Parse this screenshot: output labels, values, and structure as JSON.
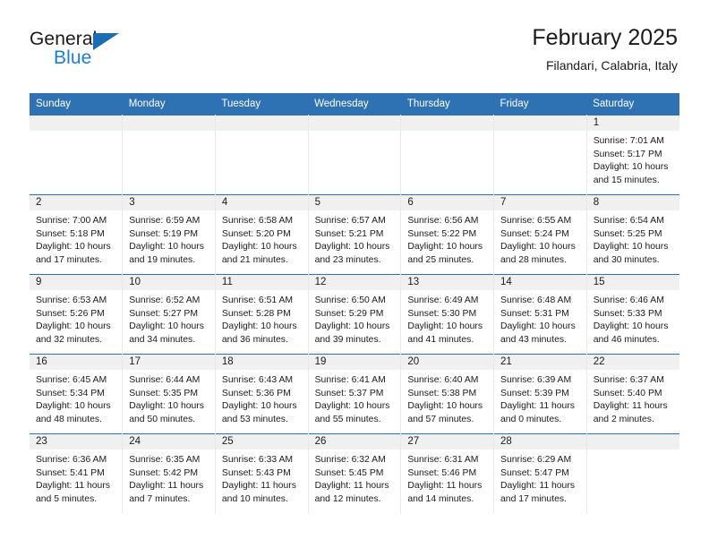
{
  "brand": {
    "name_top": "General",
    "name_bottom": "Blue",
    "triangle_icon": "brand-triangle-icon",
    "accent_color": "#1b7fd4"
  },
  "header": {
    "title": "February 2025",
    "subtitle": "Filandari, Calabria, Italy",
    "header_bg": "#2f72b4",
    "daynum_bg": "#f0f0f0"
  },
  "weekdays": [
    "Sunday",
    "Monday",
    "Tuesday",
    "Wednesday",
    "Thursday",
    "Friday",
    "Saturday"
  ],
  "labels": {
    "sunrise": "Sunrise:",
    "sunset": "Sunset:",
    "daylight": "Daylight:"
  },
  "weeks": [
    [
      {
        "day": ""
      },
      {
        "day": ""
      },
      {
        "day": ""
      },
      {
        "day": ""
      },
      {
        "day": ""
      },
      {
        "day": ""
      },
      {
        "day": "1",
        "sunrise": "Sunrise: 7:01 AM",
        "sunset": "Sunset: 5:17 PM",
        "daylight_line1": "Daylight: 10 hours",
        "daylight_line2": "and 15 minutes."
      }
    ],
    [
      {
        "day": "2",
        "sunrise": "Sunrise: 7:00 AM",
        "sunset": "Sunset: 5:18 PM",
        "daylight_line1": "Daylight: 10 hours",
        "daylight_line2": "and 17 minutes."
      },
      {
        "day": "3",
        "sunrise": "Sunrise: 6:59 AM",
        "sunset": "Sunset: 5:19 PM",
        "daylight_line1": "Daylight: 10 hours",
        "daylight_line2": "and 19 minutes."
      },
      {
        "day": "4",
        "sunrise": "Sunrise: 6:58 AM",
        "sunset": "Sunset: 5:20 PM",
        "daylight_line1": "Daylight: 10 hours",
        "daylight_line2": "and 21 minutes."
      },
      {
        "day": "5",
        "sunrise": "Sunrise: 6:57 AM",
        "sunset": "Sunset: 5:21 PM",
        "daylight_line1": "Daylight: 10 hours",
        "daylight_line2": "and 23 minutes."
      },
      {
        "day": "6",
        "sunrise": "Sunrise: 6:56 AM",
        "sunset": "Sunset: 5:22 PM",
        "daylight_line1": "Daylight: 10 hours",
        "daylight_line2": "and 25 minutes."
      },
      {
        "day": "7",
        "sunrise": "Sunrise: 6:55 AM",
        "sunset": "Sunset: 5:24 PM",
        "daylight_line1": "Daylight: 10 hours",
        "daylight_line2": "and 28 minutes."
      },
      {
        "day": "8",
        "sunrise": "Sunrise: 6:54 AM",
        "sunset": "Sunset: 5:25 PM",
        "daylight_line1": "Daylight: 10 hours",
        "daylight_line2": "and 30 minutes."
      }
    ],
    [
      {
        "day": "9",
        "sunrise": "Sunrise: 6:53 AM",
        "sunset": "Sunset: 5:26 PM",
        "daylight_line1": "Daylight: 10 hours",
        "daylight_line2": "and 32 minutes."
      },
      {
        "day": "10",
        "sunrise": "Sunrise: 6:52 AM",
        "sunset": "Sunset: 5:27 PM",
        "daylight_line1": "Daylight: 10 hours",
        "daylight_line2": "and 34 minutes."
      },
      {
        "day": "11",
        "sunrise": "Sunrise: 6:51 AM",
        "sunset": "Sunset: 5:28 PM",
        "daylight_line1": "Daylight: 10 hours",
        "daylight_line2": "and 36 minutes."
      },
      {
        "day": "12",
        "sunrise": "Sunrise: 6:50 AM",
        "sunset": "Sunset: 5:29 PM",
        "daylight_line1": "Daylight: 10 hours",
        "daylight_line2": "and 39 minutes."
      },
      {
        "day": "13",
        "sunrise": "Sunrise: 6:49 AM",
        "sunset": "Sunset: 5:30 PM",
        "daylight_line1": "Daylight: 10 hours",
        "daylight_line2": "and 41 minutes."
      },
      {
        "day": "14",
        "sunrise": "Sunrise: 6:48 AM",
        "sunset": "Sunset: 5:31 PM",
        "daylight_line1": "Daylight: 10 hours",
        "daylight_line2": "and 43 minutes."
      },
      {
        "day": "15",
        "sunrise": "Sunrise: 6:46 AM",
        "sunset": "Sunset: 5:33 PM",
        "daylight_line1": "Daylight: 10 hours",
        "daylight_line2": "and 46 minutes."
      }
    ],
    [
      {
        "day": "16",
        "sunrise": "Sunrise: 6:45 AM",
        "sunset": "Sunset: 5:34 PM",
        "daylight_line1": "Daylight: 10 hours",
        "daylight_line2": "and 48 minutes."
      },
      {
        "day": "17",
        "sunrise": "Sunrise: 6:44 AM",
        "sunset": "Sunset: 5:35 PM",
        "daylight_line1": "Daylight: 10 hours",
        "daylight_line2": "and 50 minutes."
      },
      {
        "day": "18",
        "sunrise": "Sunrise: 6:43 AM",
        "sunset": "Sunset: 5:36 PM",
        "daylight_line1": "Daylight: 10 hours",
        "daylight_line2": "and 53 minutes."
      },
      {
        "day": "19",
        "sunrise": "Sunrise: 6:41 AM",
        "sunset": "Sunset: 5:37 PM",
        "daylight_line1": "Daylight: 10 hours",
        "daylight_line2": "and 55 minutes."
      },
      {
        "day": "20",
        "sunrise": "Sunrise: 6:40 AM",
        "sunset": "Sunset: 5:38 PM",
        "daylight_line1": "Daylight: 10 hours",
        "daylight_line2": "and 57 minutes."
      },
      {
        "day": "21",
        "sunrise": "Sunrise: 6:39 AM",
        "sunset": "Sunset: 5:39 PM",
        "daylight_line1": "Daylight: 11 hours",
        "daylight_line2": "and 0 minutes."
      },
      {
        "day": "22",
        "sunrise": "Sunrise: 6:37 AM",
        "sunset": "Sunset: 5:40 PM",
        "daylight_line1": "Daylight: 11 hours",
        "daylight_line2": "and 2 minutes."
      }
    ],
    [
      {
        "day": "23",
        "sunrise": "Sunrise: 6:36 AM",
        "sunset": "Sunset: 5:41 PM",
        "daylight_line1": "Daylight: 11 hours",
        "daylight_line2": "and 5 minutes."
      },
      {
        "day": "24",
        "sunrise": "Sunrise: 6:35 AM",
        "sunset": "Sunset: 5:42 PM",
        "daylight_line1": "Daylight: 11 hours",
        "daylight_line2": "and 7 minutes."
      },
      {
        "day": "25",
        "sunrise": "Sunrise: 6:33 AM",
        "sunset": "Sunset: 5:43 PM",
        "daylight_line1": "Daylight: 11 hours",
        "daylight_line2": "and 10 minutes."
      },
      {
        "day": "26",
        "sunrise": "Sunrise: 6:32 AM",
        "sunset": "Sunset: 5:45 PM",
        "daylight_line1": "Daylight: 11 hours",
        "daylight_line2": "and 12 minutes."
      },
      {
        "day": "27",
        "sunrise": "Sunrise: 6:31 AM",
        "sunset": "Sunset: 5:46 PM",
        "daylight_line1": "Daylight: 11 hours",
        "daylight_line2": "and 14 minutes."
      },
      {
        "day": "28",
        "sunrise": "Sunrise: 6:29 AM",
        "sunset": "Sunset: 5:47 PM",
        "daylight_line1": "Daylight: 11 hours",
        "daylight_line2": "and 17 minutes."
      },
      {
        "day": ""
      }
    ]
  ]
}
